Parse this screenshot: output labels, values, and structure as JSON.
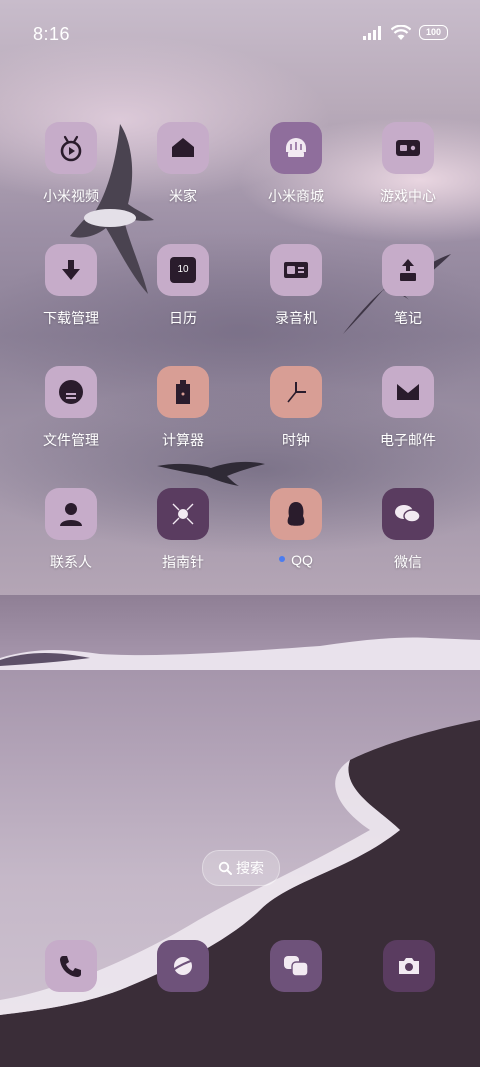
{
  "status_bar": {
    "time": "8:16",
    "battery": "100"
  },
  "apps": [
    {
      "label": "小米视频",
      "icon": "tv-play-icon"
    },
    {
      "label": "米家",
      "icon": "home-icon"
    },
    {
      "label": "小米商城",
      "icon": "store-bag-icon"
    },
    {
      "label": "游戏中心",
      "icon": "game-console-icon"
    },
    {
      "label": "下载管理",
      "icon": "download-arrow-icon"
    },
    {
      "label": "日历",
      "icon": "calendar-icon",
      "badge": "10"
    },
    {
      "label": "录音机",
      "icon": "recorder-icon"
    },
    {
      "label": "笔记",
      "icon": "note-icon"
    },
    {
      "label": "文件管理",
      "icon": "file-manager-icon"
    },
    {
      "label": "计算器",
      "icon": "calculator-icon"
    },
    {
      "label": "时钟",
      "icon": "clock-icon"
    },
    {
      "label": "电子邮件",
      "icon": "mail-icon"
    },
    {
      "label": "联系人",
      "icon": "contact-person-icon"
    },
    {
      "label": "指南针",
      "icon": "compass-icon"
    },
    {
      "label": "QQ",
      "icon": "qq-penguin-icon"
    },
    {
      "label": "微信",
      "icon": "wechat-icon"
    }
  ],
  "search": {
    "label": "搜索"
  },
  "dock": [
    {
      "icon": "phone-icon"
    },
    {
      "icon": "browser-planet-icon"
    },
    {
      "icon": "messages-icon"
    },
    {
      "icon": "camera-icon"
    }
  ],
  "colors": {
    "icon_light": "#c6acc9",
    "icon_peach": "#d89e95",
    "icon_purple": "#8f6e9c",
    "icon_dark": "#5a3c60",
    "glyph": "#2a1c2c",
    "notification_dot": "#4b7cf0"
  }
}
